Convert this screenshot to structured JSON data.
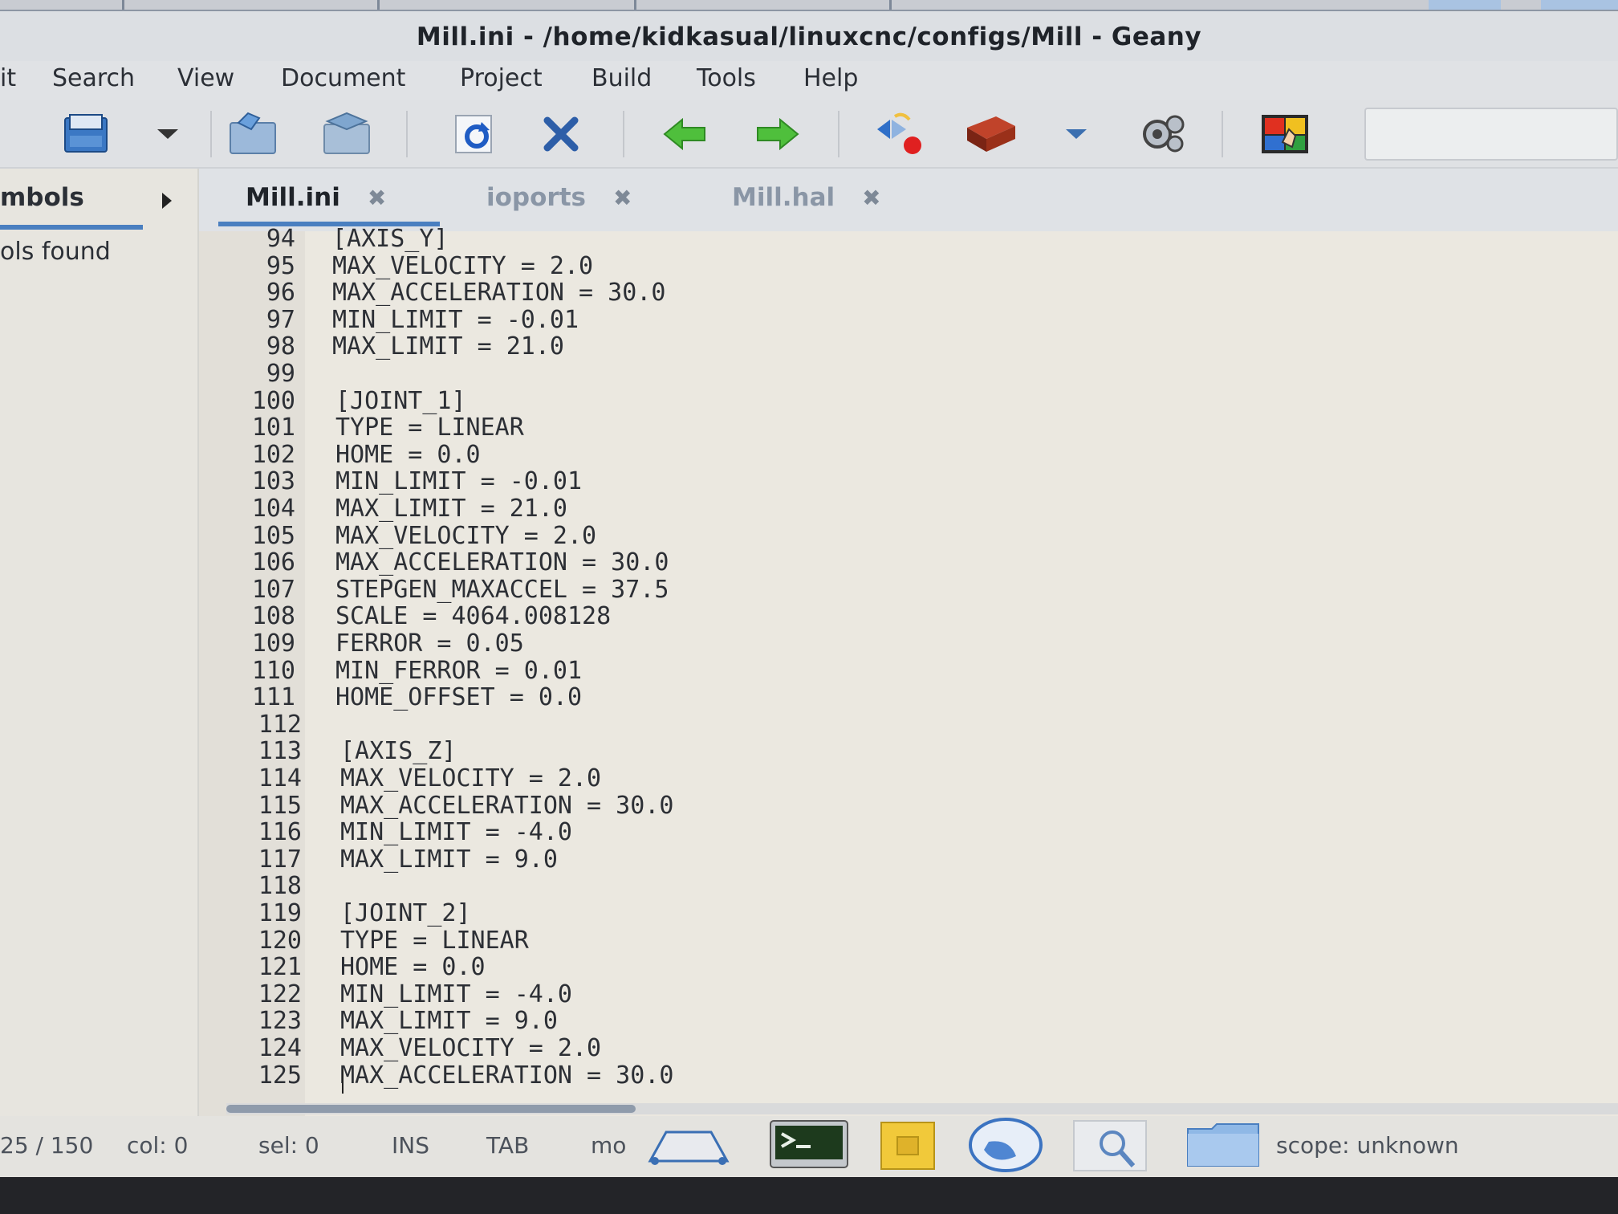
{
  "window": {
    "title": "Mill.ini - /home/kidkasual/linuxcnc/configs/Mill - Geany"
  },
  "menu": [
    {
      "id": "edit",
      "label": "it"
    },
    {
      "id": "search",
      "label": "Search"
    },
    {
      "id": "view",
      "label": "View"
    },
    {
      "id": "document",
      "label": "Document"
    },
    {
      "id": "project",
      "label": "Project"
    },
    {
      "id": "build",
      "label": "Build"
    },
    {
      "id": "tools",
      "label": "Tools"
    },
    {
      "id": "help",
      "label": "Help"
    }
  ],
  "toolbar": {
    "icons": [
      "new-file-icon",
      "open-file-icon",
      "open-recent-dropdown-icon",
      "save-icon",
      "save-all-icon",
      "reload-icon",
      "close-file-icon",
      "navigate-back-icon",
      "navigate-forward-icon",
      "compile-icon",
      "build-icon",
      "build-dropdown-icon",
      "execute-icon",
      "color-chooser-icon"
    ]
  },
  "sidebar": {
    "tab_label": "mbols",
    "message": "ols found"
  },
  "tabs": [
    {
      "label": "Mill.ini",
      "active": true
    },
    {
      "label": "ioports",
      "active": false
    },
    {
      "label": "Mill.hal",
      "active": false
    }
  ],
  "editor": {
    "lines": [
      {
        "num": "94",
        "text": "[AXIS_Y]"
      },
      {
        "num": "95",
        "text": "MAX_VELOCITY = 2.0"
      },
      {
        "num": "96",
        "text": "MAX_ACCELERATION = 30.0"
      },
      {
        "num": "97",
        "text": "MIN_LIMIT = -0.01"
      },
      {
        "num": "98",
        "text": "MAX_LIMIT = 21.0"
      },
      {
        "num": "99",
        "text": ""
      },
      {
        "num": "100",
        "text": "[JOINT_1]"
      },
      {
        "num": "101",
        "text": "TYPE = LINEAR"
      },
      {
        "num": "102",
        "text": "HOME = 0.0"
      },
      {
        "num": "103",
        "text": "MIN_LIMIT = -0.01"
      },
      {
        "num": "104",
        "text": "MAX_LIMIT = 21.0"
      },
      {
        "num": "105",
        "text": "MAX_VELOCITY = 2.0"
      },
      {
        "num": "106",
        "text": "MAX_ACCELERATION = 30.0"
      },
      {
        "num": "107",
        "text": "STEPGEN_MAXACCEL = 37.5"
      },
      {
        "num": "108",
        "text": "SCALE = 4064.008128"
      },
      {
        "num": "109",
        "text": "FERROR = 0.05"
      },
      {
        "num": "110",
        "text": "MIN_FERROR = 0.01"
      },
      {
        "num": "111",
        "text": "HOME_OFFSET = 0.0"
      },
      {
        "num": "112",
        "text": ""
      },
      {
        "num": "113",
        "text": "[AXIS_Z]"
      },
      {
        "num": "114",
        "text": "MAX_VELOCITY = 2.0"
      },
      {
        "num": "115",
        "text": "MAX_ACCELERATION = 30.0"
      },
      {
        "num": "116",
        "text": "MIN_LIMIT = -4.0"
      },
      {
        "num": "117",
        "text": "MAX_LIMIT = 9.0"
      },
      {
        "num": "118",
        "text": ""
      },
      {
        "num": "119",
        "text": "[JOINT_2]"
      },
      {
        "num": "120",
        "text": "TYPE = LINEAR"
      },
      {
        "num": "121",
        "text": "HOME = 0.0"
      },
      {
        "num": "122",
        "text": "MIN_LIMIT = -4.0"
      },
      {
        "num": "123",
        "text": "MAX_LIMIT = 9.0"
      },
      {
        "num": "124",
        "text": "MAX_VELOCITY = 2.0"
      },
      {
        "num": "125",
        "text": "MAX_ACCELERATION = 30.0"
      }
    ]
  },
  "statusbar": {
    "position": "25 / 150",
    "col": "col: 0",
    "sel": "sel: 0",
    "mode": "INS",
    "indent": "TAB",
    "mo": "mo",
    "scope": "scope: unknown"
  },
  "taskbar": {
    "icons": [
      "eject-icon",
      "terminal-icon",
      "notes-icon",
      "globe-icon",
      "magnifier-icon",
      "folder-icon"
    ]
  },
  "colors": {
    "accent": "#4a7fc0",
    "editor_bg": "#ebe8e0",
    "gutter_bg": "#e2dfd8"
  }
}
